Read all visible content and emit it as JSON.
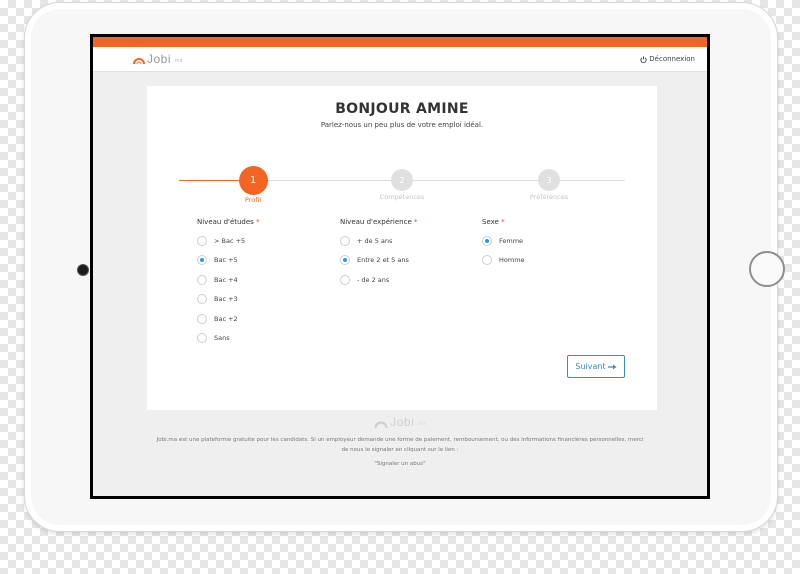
{
  "colors": {
    "accent": "#f26522",
    "radio": "#2a9bd6",
    "button": "#3a8bc4"
  },
  "header": {
    "logo_text": "Jobi",
    "logo_suffix": ".ma",
    "logout_icon": "power-icon",
    "logout_label": "Déconnexion"
  },
  "page": {
    "title": "BONJOUR AMINE",
    "subtitle": "Parlez-nous un peu plus de votre emploi idéal."
  },
  "steps": [
    {
      "number": "1",
      "label": "Profil",
      "active": true
    },
    {
      "number": "2",
      "label": "Compétences",
      "active": false
    },
    {
      "number": "3",
      "label": "Préférences",
      "active": false
    }
  ],
  "fields": {
    "education": {
      "label": "Niveau d'études",
      "required": "*",
      "options": [
        "> Bac +5",
        "Bac +5",
        "Bac +4",
        "Bac +3",
        "Bac +2",
        "Sans"
      ],
      "selected": "Bac +5"
    },
    "experience": {
      "label": "Niveau d'expérience",
      "required": "*",
      "options": [
        "+ de 5 ans",
        "Entre 2 et 5 ans",
        "- de 2 ans"
      ],
      "selected": "Entre 2 et 5 ans"
    },
    "gender": {
      "label": "Sexe",
      "required": "*",
      "options": [
        "Femme",
        "Homme"
      ],
      "selected": "Femme"
    }
  },
  "next_button": {
    "label": "Suivant",
    "icon": "arrow-right-icon"
  },
  "footer": {
    "logo_text": "Jobi",
    "logo_suffix": ".ma",
    "text": "Jobi.ma est une plateforme gratuite pour les candidats. Si un employeur demande une forme de paiement, remboursement, ou des informations financières personnelles, merci de nous le signaler en cliquant sur le lien :",
    "link": "\"Signaler un abus\""
  }
}
